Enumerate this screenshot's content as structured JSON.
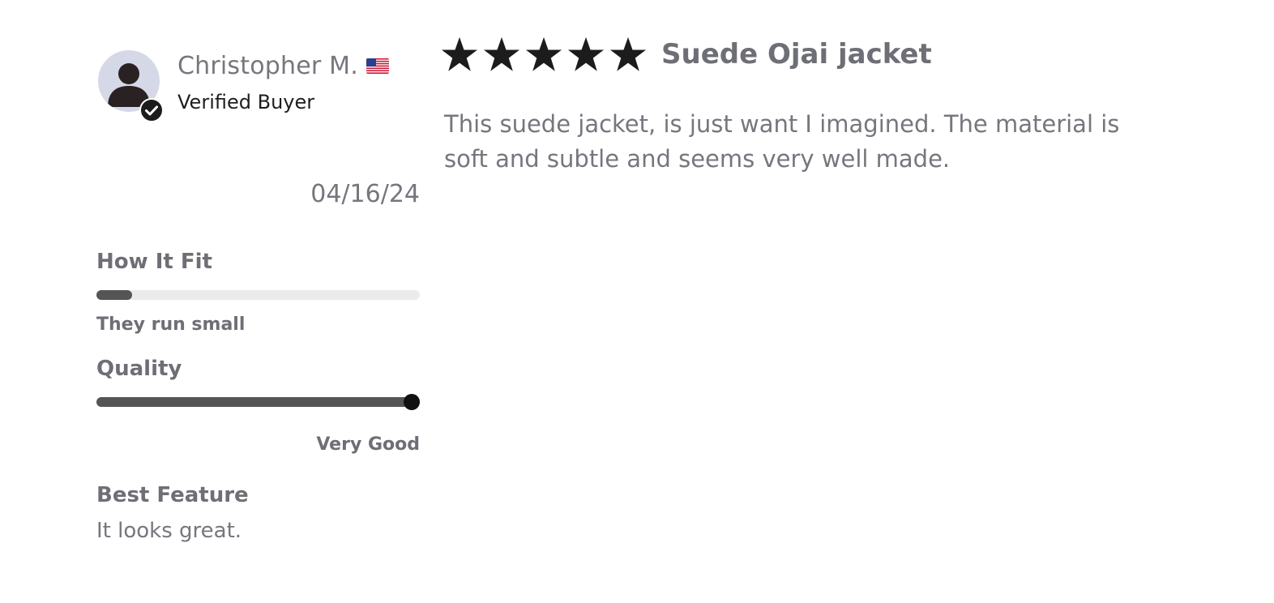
{
  "reviewer": {
    "name": "Christopher M.",
    "country_flag": "us-flag",
    "verified_label": "Verified Buyer",
    "avatar_icon": "user-avatar-icon",
    "badge_icon": "check-circle-icon"
  },
  "review": {
    "date": "04/16/24",
    "rating": 5,
    "rating_max": 5,
    "title": "Suede Ojai jacket",
    "body": "This suede jacket, is just want I imagined. The material is soft and subtle and seems very well made."
  },
  "attributes": {
    "fit": {
      "label": "How It Fit",
      "value_fraction": 0.11,
      "caption": "They run small"
    },
    "quality": {
      "label": "Quality",
      "value_fraction": 1.0,
      "caption": "Very Good"
    },
    "best_feature": {
      "label": "Best Feature",
      "value": "It looks great."
    }
  },
  "colors": {
    "star": "#1c1c1c",
    "bar_track": "#ebebeb",
    "bar_fill": "#555555",
    "text_muted": "#76767e",
    "avatar_bg": "#d5d8e6"
  }
}
